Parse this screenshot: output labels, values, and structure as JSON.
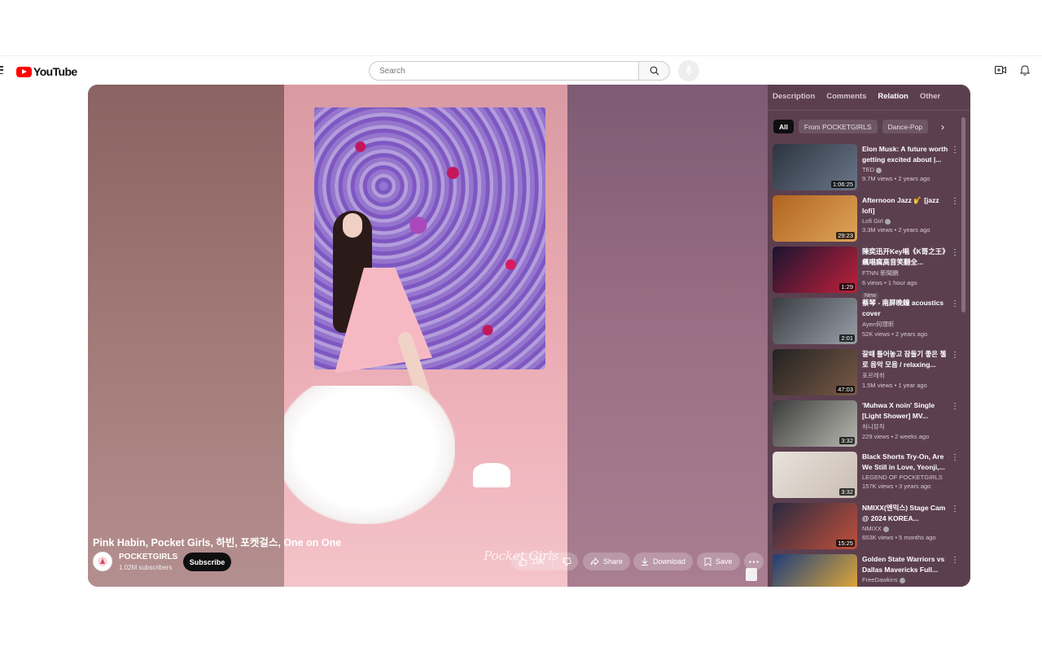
{
  "header": {
    "logo_text": "YouTube",
    "search_placeholder": "Search"
  },
  "video": {
    "title": "Pink Habin, Pocket Girls, 하빈, 포켓걸스, One on One",
    "watermark": "Pocket Girls",
    "channel": {
      "name": "POCKETGIRLS",
      "subscribers": "1.02M subscribers"
    },
    "subscribe_label": "Subscribe",
    "likes": "19K",
    "share_label": "Share",
    "download_label": "Download",
    "save_label": "Save"
  },
  "sidebar": {
    "tabs": [
      "Description",
      "Comments",
      "Relation",
      "Other"
    ],
    "active_tab": "Relation",
    "chips": [
      "All",
      "From POCKETGIRLS",
      "Dance-Pop"
    ],
    "videos": [
      {
        "title": "Elon Musk: A future worth getting excited about |...",
        "channel": "TED",
        "verified": true,
        "views": "9.7M views",
        "age": "2 years ago",
        "duration": "1:06:25",
        "thumb_colors": [
          "#2c3440",
          "#6a7788"
        ]
      },
      {
        "title": "Afternoon Jazz 🎷 [jazz lofi]",
        "channel": "Lofi Girl",
        "verified": true,
        "views": "3.3M views",
        "age": "2 years ago",
        "duration": "29:23",
        "thumb_colors": [
          "#b0641f",
          "#e0a45a"
        ]
      },
      {
        "title": "陳奕迅开Key唱《K哥之王》 飆唱瘋高音笑翻全...",
        "channel": "FTNN 新聞網",
        "verified": false,
        "views": "6 views",
        "age": "1 hour ago",
        "duration": "1:29",
        "badge": "New",
        "thumb_colors": [
          "#1a1430",
          "#c0203a"
        ]
      },
      {
        "title": "蔡琴 - 南屏晚鐘 acoustics cover",
        "channel": "Ayen何璟昕",
        "verified": false,
        "views": "52K views",
        "age": "2 years ago",
        "duration": "2:01",
        "thumb_colors": [
          "#3a3d44",
          "#9aa0a8"
        ]
      },
      {
        "title": "잘때 틀어놓고 잠들기 좋은 첼로 음악 모음 / relaxing...",
        "channel": "포르레히",
        "verified": false,
        "views": "1.5M views",
        "age": "1 year ago",
        "duration": "47:03",
        "thumb_colors": [
          "#222",
          "#7a5a46"
        ]
      },
      {
        "title": "'Muhwa X noin' Single [Light Shower] MV...",
        "channel": "허니뮤직",
        "verified": false,
        "views": "229 views",
        "age": "2 weeks ago",
        "duration": "3:32",
        "thumb_colors": [
          "#3c3c3c",
          "#b8b8b0"
        ]
      },
      {
        "title": "Black Shorts Try-On, Are We Still in Love, Yeonji,...",
        "channel": "LEGEND OF POCKETGIRLS",
        "verified": false,
        "views": "157K views",
        "age": "3 years ago",
        "duration": "3:32",
        "thumb_colors": [
          "#e8e2dc",
          "#c9bdb2"
        ]
      },
      {
        "title": "NMIXX(엔믹스) Stage Cam @ 2024 KOREA...",
        "channel": "NMIXX",
        "verified": true,
        "views": "653K views",
        "age": "5 months ago",
        "duration": "15:25",
        "thumb_colors": [
          "#2a2a40",
          "#c2503a"
        ]
      },
      {
        "title": "Golden State Warriors vs Dallas Mavericks Full...",
        "channel": "FreeDawkins",
        "verified": true,
        "views": "",
        "age": "",
        "duration": "",
        "thumb_colors": [
          "#1d3d7a",
          "#f2b233"
        ]
      }
    ]
  }
}
